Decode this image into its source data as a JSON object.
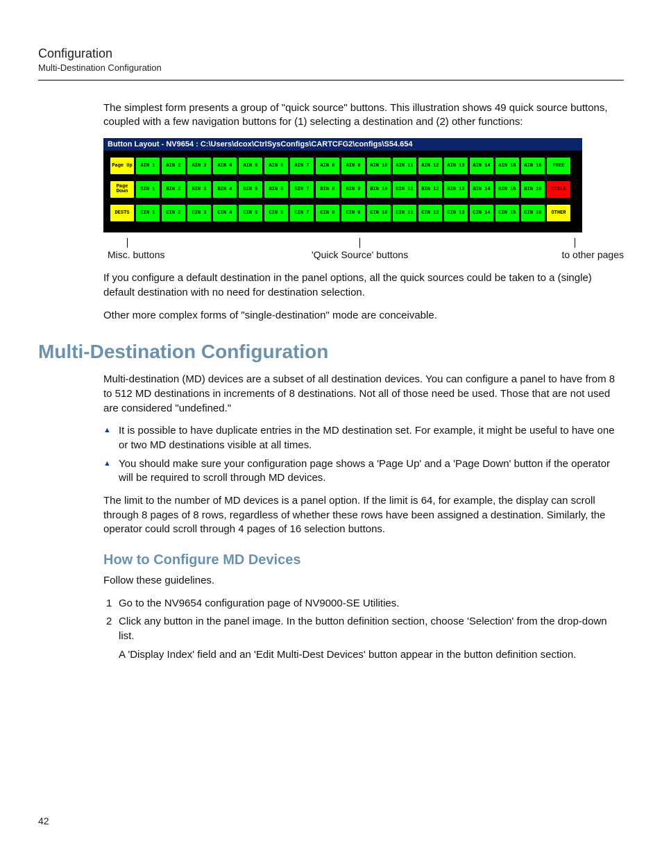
{
  "header": {
    "title": "Configuration",
    "subtitle": "Multi-Destination Configuration"
  },
  "intro": "The simplest form presents a group of \"quick source\" buttons. This illustration shows 49 quick source buttons, coupled with a few navigation buttons for (1) selecting a destination and (2) other functions:",
  "figure": {
    "titlebar": "Button Layout - NV9654 : C:\\Users\\dcox\\CtrlSysConfigs\\CARTCFG2\\configs\\S54.654",
    "rows": [
      [
        {
          "text": "Page Up",
          "cls": "btn-yellow"
        },
        {
          "text": "AIN 1",
          "cls": "btn-green"
        },
        {
          "text": "AIN 2",
          "cls": "btn-green"
        },
        {
          "text": "AIN 3",
          "cls": "btn-green"
        },
        {
          "text": "AIN 4",
          "cls": "btn-green"
        },
        {
          "text": "AIN 5",
          "cls": "btn-green"
        },
        {
          "text": "AIN 6",
          "cls": "btn-green"
        },
        {
          "text": "AIN 7",
          "cls": "btn-green"
        },
        {
          "text": "AIN 8",
          "cls": "btn-green"
        },
        {
          "text": "AIN 9",
          "cls": "btn-green"
        },
        {
          "text": "AIN 10",
          "cls": "btn-green"
        },
        {
          "text": "AIN 11",
          "cls": "btn-green"
        },
        {
          "text": "AIN 12",
          "cls": "btn-green"
        },
        {
          "text": "AIN 13",
          "cls": "btn-green"
        },
        {
          "text": "AIN 14",
          "cls": "btn-green"
        },
        {
          "text": "AIN 15",
          "cls": "btn-green"
        },
        {
          "text": "AIN 16",
          "cls": "btn-green"
        },
        {
          "text": "FREE",
          "cls": "btn-green"
        }
      ],
      [
        {
          "text": "Page Down",
          "cls": "btn-yellow"
        },
        {
          "text": "BIN 1",
          "cls": "btn-green"
        },
        {
          "text": "BIN 2",
          "cls": "btn-green"
        },
        {
          "text": "BIN 3",
          "cls": "btn-green"
        },
        {
          "text": "BIN 4",
          "cls": "btn-green"
        },
        {
          "text": "BIN 5",
          "cls": "btn-green"
        },
        {
          "text": "BIN 6",
          "cls": "btn-green"
        },
        {
          "text": "BIN 7",
          "cls": "btn-green"
        },
        {
          "text": "BIN 8",
          "cls": "btn-green"
        },
        {
          "text": "BIN 9",
          "cls": "btn-green"
        },
        {
          "text": "BIN 10",
          "cls": "btn-green"
        },
        {
          "text": "BIN 11",
          "cls": "btn-green"
        },
        {
          "text": "BIN 12",
          "cls": "btn-green"
        },
        {
          "text": "BIN 13",
          "cls": "btn-green"
        },
        {
          "text": "BIN 14",
          "cls": "btn-green"
        },
        {
          "text": "BIN 15",
          "cls": "btn-green"
        },
        {
          "text": "BIN 16",
          "cls": "btn-green"
        },
        {
          "text": "UTILS",
          "cls": "btn-red"
        }
      ],
      [
        {
          "text": "DESTS",
          "cls": "btn-yellow"
        },
        {
          "text": "CIN 1",
          "cls": "btn-green"
        },
        {
          "text": "CIN 2",
          "cls": "btn-green"
        },
        {
          "text": "CIN 3",
          "cls": "btn-green"
        },
        {
          "text": "CIN 4",
          "cls": "btn-green"
        },
        {
          "text": "CIN 5",
          "cls": "btn-green"
        },
        {
          "text": "CIN 6",
          "cls": "btn-green"
        },
        {
          "text": "CIN 7",
          "cls": "btn-green"
        },
        {
          "text": "CIN 8",
          "cls": "btn-green"
        },
        {
          "text": "CIN 9",
          "cls": "btn-green"
        },
        {
          "text": "CIN 10",
          "cls": "btn-green"
        },
        {
          "text": "CIN 11",
          "cls": "btn-green"
        },
        {
          "text": "CIN 12",
          "cls": "btn-green"
        },
        {
          "text": "CIN 13",
          "cls": "btn-green"
        },
        {
          "text": "CIN 14",
          "cls": "btn-green"
        },
        {
          "text": "CIN 15",
          "cls": "btn-green"
        },
        {
          "text": "CIN 16",
          "cls": "btn-green"
        },
        {
          "text": "OTHER",
          "cls": "btn-yellow"
        }
      ]
    ]
  },
  "callouts": {
    "misc": "Misc. buttons",
    "quick": "'Quick Source' buttons",
    "other": "to other pages"
  },
  "after_fig_p1": "If you configure a default destination in the panel options, all the quick sources could be taken to a (single) default destination with no need for destination selection.",
  "after_fig_p2": "Other more complex forms of \"single-destination\" mode are conceivable.",
  "h1": "Multi-Destination Configuration",
  "md_p1": "Multi-destination (MD) devices are a subset of all destination devices. You can configure a panel to have from 8 to 512 MD destinations in increments of 8 destinations. Not all of those need be used. Those that are not used are considered \"undefined.\"",
  "md_bullets": [
    "It is possible to have duplicate entries in the MD destination set. For example, it might be useful to have one or two MD destinations visible at all times.",
    "You should make sure your configuration page shows a 'Page Up' and a 'Page Down' button if the operator will be required to scroll through MD devices."
  ],
  "md_p2": "The limit to the number of MD devices is a panel option. If the limit is 64, for example, the display can scroll through 8 pages of 8 rows, regardless of whether these rows have been assigned a destination. Similarly, the operator could scroll through 4 pages of 16 selection buttons.",
  "h2": "How to Configure MD Devices",
  "how_intro": "Follow these guidelines.",
  "steps": [
    {
      "main": "Go to the NV9654 configuration page of NV9000-SE Utilities."
    },
    {
      "main": "Click any button in the panel image. In the button definition section, choose 'Selection' from the drop-down list.",
      "sub": "A 'Display Index' field and an 'Edit Multi-Dest Devices' button appear in the button definition section."
    }
  ],
  "pagenum": "42"
}
